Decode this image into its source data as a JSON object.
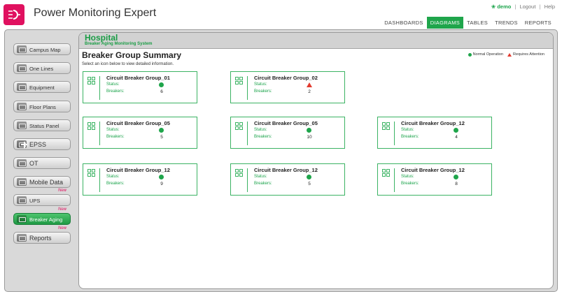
{
  "app": {
    "title": "Power Monitoring Expert",
    "user": "demo",
    "logout": "Logout",
    "help": "Help"
  },
  "nav": [
    {
      "label": "DASHBOARDS",
      "active": false
    },
    {
      "label": "DIAGRAMS",
      "active": true
    },
    {
      "label": "TABLES",
      "active": false
    },
    {
      "label": "TRENDS",
      "active": false
    },
    {
      "label": "REPORTS",
      "active": false
    }
  ],
  "sidebar": {
    "items": [
      {
        "label": "Campus Map",
        "icon": "map-icon"
      },
      {
        "label": "One Lines",
        "icon": "one-lines-icon"
      },
      {
        "label": "Equipment",
        "icon": "equipment-icon"
      },
      {
        "label": "Floor Plans",
        "icon": "floor-plans-icon"
      },
      {
        "label": "Status Panel",
        "icon": "status-panel-icon"
      },
      {
        "label": "EPSS",
        "icon": "plus-icon"
      },
      {
        "label": "OT",
        "icon": "ot-icon"
      },
      {
        "label": "Mobile Data",
        "icon": "mobile-data-icon"
      },
      {
        "label": "UPS",
        "icon": "ups-icon",
        "badge": "New"
      },
      {
        "label": "Breaker Aging",
        "icon": "breaker-aging-icon",
        "badge": "New",
        "active": true
      },
      {
        "label": "Reports",
        "icon": "reports-icon",
        "badge": "New"
      }
    ]
  },
  "main": {
    "site_name": "Hospital",
    "site_subtitle": "Breaker Aging Monitoring System",
    "page_title": "Breaker Group Summary",
    "instruction": "Select an icon below to view detailed information.",
    "legend": {
      "normal": "Normal Operation",
      "attention": "Requires Attention",
      "normal_color": "#1fa54b",
      "attention_color": "#e23b2f"
    },
    "status_label": "Status:",
    "breakers_label": "Breakers:",
    "cards": [
      {
        "title": "Circuit Breaker Group_01",
        "status": "normal",
        "breakers": "6"
      },
      {
        "title": "Circuit Breaker Group_02",
        "status": "attention",
        "breakers": "2"
      },
      {
        "title": "Circuit Breaker Group_05",
        "status": "normal",
        "breakers": "5"
      },
      {
        "title": "Circuit Breaker Group_05",
        "status": "normal",
        "breakers": "10"
      },
      {
        "title": "Circuit Breaker Group_12",
        "status": "normal",
        "breakers": "4"
      },
      {
        "title": "Circuit Breaker Group_12",
        "status": "normal",
        "breakers": "9"
      },
      {
        "title": "Circuit Breaker Group_12",
        "status": "normal",
        "breakers": "5"
      },
      {
        "title": "Circuit Breaker Group_12",
        "status": "normal",
        "breakers": "8"
      }
    ]
  }
}
